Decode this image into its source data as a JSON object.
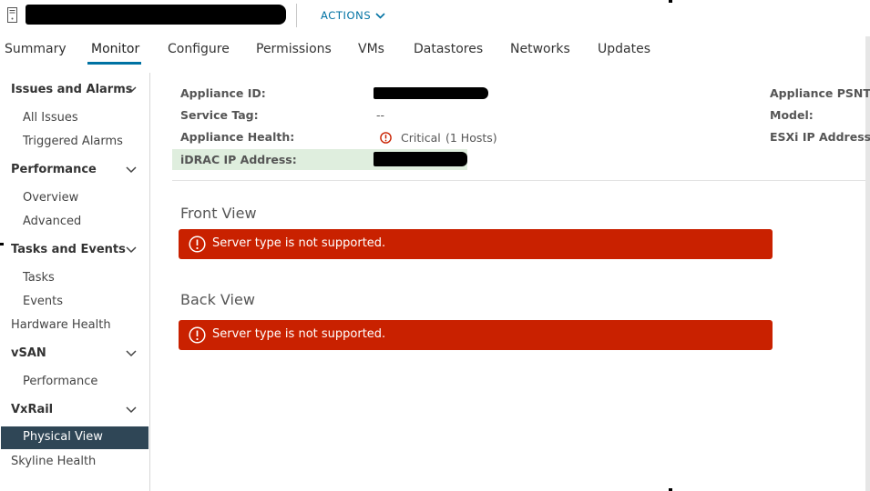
{
  "header": {
    "host_icon": "server-icon",
    "actions_label": "ACTIONS",
    "actions_icon": "chevron-down-icon"
  },
  "tabs": [
    {
      "label": "Summary"
    },
    {
      "label": "Monitor",
      "active": true
    },
    {
      "label": "Configure"
    },
    {
      "label": "Permissions"
    },
    {
      "label": "VMs"
    },
    {
      "label": "Datastores"
    },
    {
      "label": "Networks"
    },
    {
      "label": "Updates"
    }
  ],
  "sidebar": {
    "issues": {
      "label": "Issues and Alarms",
      "items": [
        "All Issues",
        "Triggered Alarms"
      ]
    },
    "performance": {
      "label": "Performance",
      "items": [
        "Overview",
        "Advanced"
      ]
    },
    "tasks": {
      "label": "Tasks and Events",
      "items": [
        "Tasks",
        "Events"
      ]
    },
    "hardware_health": "Hardware Health",
    "vsan": {
      "label": "vSAN",
      "items": [
        "Performance"
      ]
    },
    "vxrail": {
      "label": "VxRail",
      "items": [
        "Physical View"
      ]
    },
    "skyline_health": "Skyline Health",
    "selected": "Physical View"
  },
  "details": {
    "appliance_id_label": "Appliance ID:",
    "service_tag_label": "Service Tag:",
    "service_tag_value": "--",
    "appliance_health_label": "Appliance Health:",
    "health_status": "Critical",
    "health_hosts": "(1 Hosts)",
    "health_icon": "critical-alert-icon",
    "idrac_label": "iDRAC IP Address:",
    "appliance_psnt_label": "Appliance PSNT:",
    "model_label": "Model:",
    "esxi_label": "ESXi IP Address:"
  },
  "front_view": {
    "title": "Front View",
    "alert_text": "Server type is not supported."
  },
  "back_view": {
    "title": "Back View",
    "alert_text": "Server type is not supported."
  },
  "colors": {
    "accent": "#0072a3",
    "alert_bg": "#c92100",
    "selected_bg": "#2f4656",
    "highlight_bg": "#dfeede",
    "critical": "#c92100"
  }
}
